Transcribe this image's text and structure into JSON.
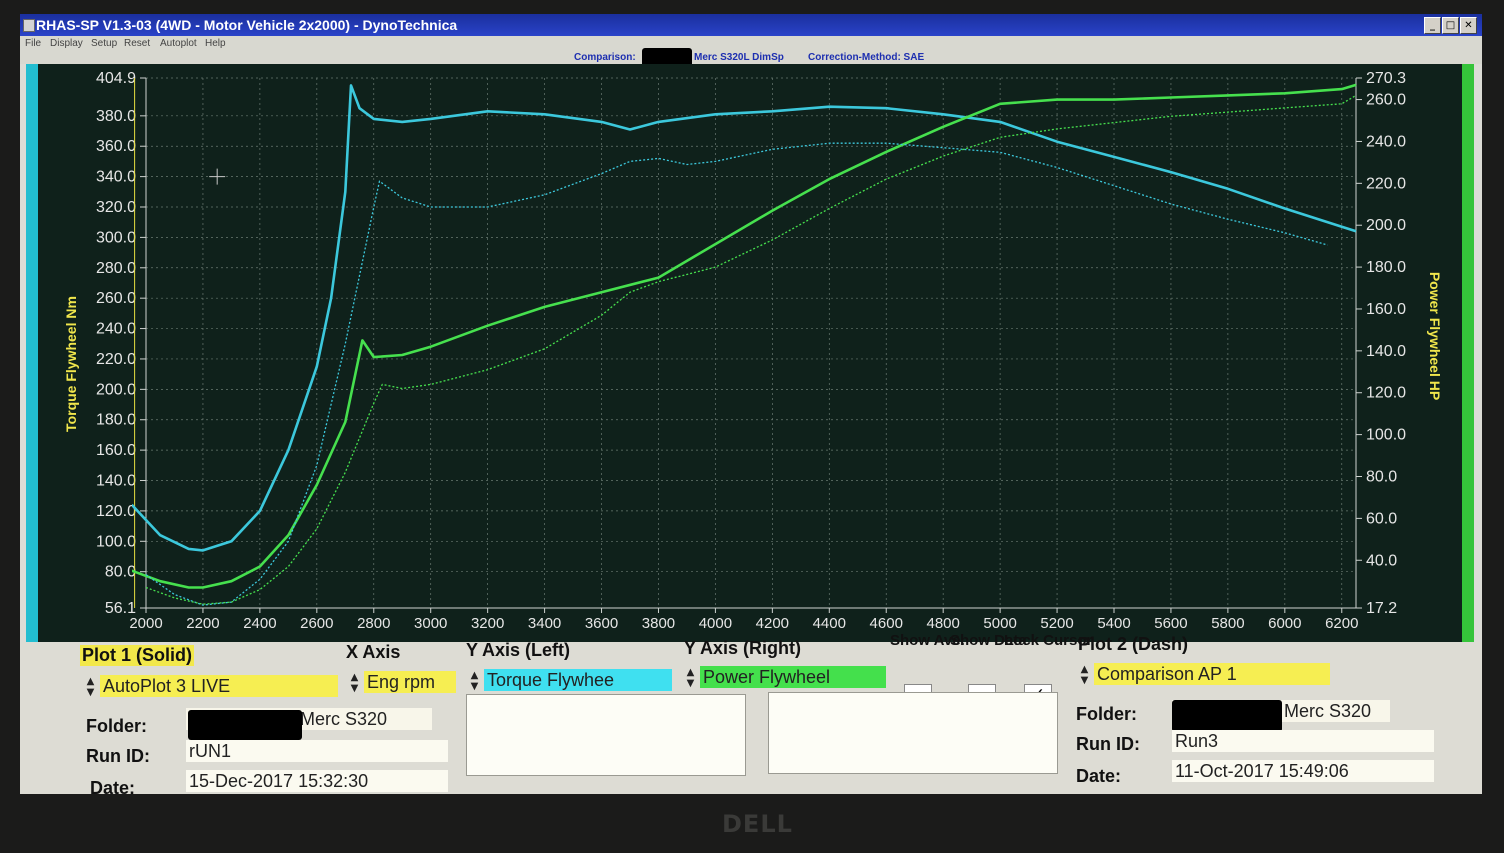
{
  "window": {
    "title": "RHAS-SP V1.3-03  (4WD - Motor Vehicle 2x2000) - DynoTechnica",
    "controls": [
      "_",
      "□",
      "✕"
    ]
  },
  "menu": [
    "File",
    "Display",
    "Setup",
    "Reset",
    "Autoplot",
    "Help"
  ],
  "info": {
    "comparison_label": "Comparison:",
    "comparison_value": "Merc S320L DimSp",
    "correction": "Correction-Method: SAE"
  },
  "colors": {
    "torque_line": "#3cc8dc",
    "power_line": "#46e04e",
    "axis_text": "#e6e6e6",
    "left_label": "#f0e64c",
    "right_label": "#f0e64c",
    "grid": "#6a7a72",
    "cursor_line": "#e8e040"
  },
  "chart_data": {
    "type": "line",
    "xlabel": "",
    "ylabel_left": "Torque Flywheel Nm",
    "ylabel_right": "Power Flywheel HP",
    "x_ticks": [
      2000,
      2200,
      2400,
      2600,
      2800,
      3000,
      3200,
      3400,
      3600,
      3800,
      4000,
      4200,
      4400,
      4600,
      4800,
      5000,
      5200,
      5400,
      5600,
      5800,
      6000,
      6200
    ],
    "x_range": [
      2000,
      6250
    ],
    "y_left_ticks": [
      "404.9",
      "380.0",
      "360.0",
      "340.0",
      "320.0",
      "300.0",
      "280.0",
      "260.0",
      "240.0",
      "220.0",
      "200.0",
      "180.0",
      "160.0",
      "140.0",
      "120.0",
      "100.0",
      "80.0",
      "56.1"
    ],
    "y_left_range": [
      56.1,
      404.9
    ],
    "y_right_ticks": [
      "270.3",
      "260.0",
      "240.0",
      "220.0",
      "200.0",
      "180.0",
      "160.0",
      "140.0",
      "120.0",
      "100.0",
      "80.0",
      "60.0",
      "40.0",
      "17.2"
    ],
    "y_right_range": [
      17.2,
      270.3
    ],
    "cursor_x": 1960,
    "grid": true,
    "series": [
      {
        "name": "",
        "axis": "left",
        "style": "solid",
        "color": "#3cc8dc",
        "x": [
          1950,
          2050,
          2150,
          2200,
          2300,
          2400,
          2500,
          2600,
          2650,
          2700,
          2720,
          2750,
          2800,
          2900,
          3000,
          3200,
          3400,
          3600,
          3700,
          3800,
          4000,
          4200,
          4400,
          4600,
          4800,
          5000,
          5200,
          5400,
          5600,
          5800,
          6000,
          6200,
          6250
        ],
        "y": [
          124,
          104,
          95,
          94,
          100,
          120,
          160,
          215,
          260,
          330,
          400,
          385,
          378,
          376,
          378,
          383,
          381,
          376,
          371,
          376,
          381,
          383,
          386,
          385,
          381,
          376,
          363,
          353,
          343,
          332,
          319,
          307,
          304
        ]
      },
      {
        "name": "",
        "axis": "right",
        "style": "solid",
        "color": "#46e04e",
        "x": [
          1950,
          2050,
          2150,
          2200,
          2300,
          2400,
          2500,
          2600,
          2700,
          2760,
          2800,
          2900,
          3000,
          3200,
          3400,
          3600,
          3800,
          4000,
          4200,
          4400,
          4600,
          4800,
          5000,
          5200,
          5400,
          5600,
          5800,
          6000,
          6200,
          6250
        ],
        "y": [
          35.0,
          30.0,
          27.0,
          27.0,
          30.0,
          37.0,
          52.0,
          76.0,
          106.0,
          145.0,
          137.0,
          138.0,
          142.0,
          152.0,
          161.0,
          168.0,
          175.0,
          191.0,
          207.0,
          222.0,
          235.0,
          247.0,
          258.0,
          260.0,
          260.0,
          261.0,
          262.0,
          263.0,
          265.0,
          267.0
        ]
      },
      {
        "name": "",
        "axis": "left",
        "style": "dashed",
        "color": "#3cc8dc",
        "x": [
          2000,
          2100,
          2200,
          2300,
          2400,
          2500,
          2600,
          2700,
          2800,
          2820,
          2900,
          3000,
          3200,
          3400,
          3600,
          3700,
          3800,
          3900,
          4000,
          4200,
          4400,
          4600,
          4800,
          5000,
          5200,
          5400,
          5600,
          5800,
          6000,
          6150
        ],
        "y": [
          78,
          65,
          58,
          60,
          75,
          100,
          150,
          230,
          320,
          337,
          326,
          320,
          320,
          328,
          342,
          350,
          352,
          348,
          350,
          358,
          362,
          362,
          359,
          356,
          346,
          334,
          322,
          312,
          303,
          295
        ]
      },
      {
        "name": "",
        "axis": "right",
        "style": "dashed",
        "color": "#46e04e",
        "x": [
          2000,
          2100,
          2200,
          2300,
          2400,
          2500,
          2600,
          2700,
          2800,
          2830,
          2900,
          3000,
          3200,
          3400,
          3600,
          3700,
          3800,
          4000,
          4200,
          4400,
          4600,
          4800,
          5000,
          5200,
          5400,
          5600,
          5800,
          6000,
          6200,
          6250
        ],
        "y": [
          27.0,
          22.0,
          19.0,
          20.0,
          26.0,
          37.0,
          55.0,
          82.0,
          115.0,
          124.0,
          122.0,
          124.0,
          131.0,
          141.0,
          157.0,
          168.0,
          173.0,
          180.0,
          193.0,
          208.0,
          222.0,
          233.0,
          242.0,
          246.0,
          249.0,
          252.0,
          254.0,
          256.0,
          258.0,
          262.0
        ]
      }
    ]
  },
  "panel": {
    "plot1_title": "Plot 1 (Solid)",
    "plot1_value": "AutoPlot 3 LIVE",
    "x_axis_title": "X Axis",
    "x_axis_value": "Eng rpm",
    "y_left_title": "Y Axis (Left)",
    "y_left_value": "Torque Flywhee",
    "y_right_title": "Y Axis (Right)",
    "y_right_value": "Power Flywheel",
    "show_ave": "Show Ave.",
    "show_data": "Show Data",
    "lock_cursor": "Lock Cursor",
    "lock_cursor_checked": true,
    "show_ave_checked": false,
    "show_data_checked": false,
    "checkmark": "✓",
    "plot2_title": "Plot 2 (Dash)",
    "plot2_value": "Comparison AP 1",
    "folder_label": "Folder:",
    "runid_label": "Run ID:",
    "date_label": "Date:",
    "run1_folder": "Merc S320",
    "run1_id": "rUN1",
    "run1_date": "15-Dec-2017   15:32:30",
    "run2_folder": "Merc S320",
    "run2_id": "Run3",
    "run2_date": "11-Oct-2017   15:49:06"
  },
  "monitor": {
    "brand": "DELL"
  }
}
